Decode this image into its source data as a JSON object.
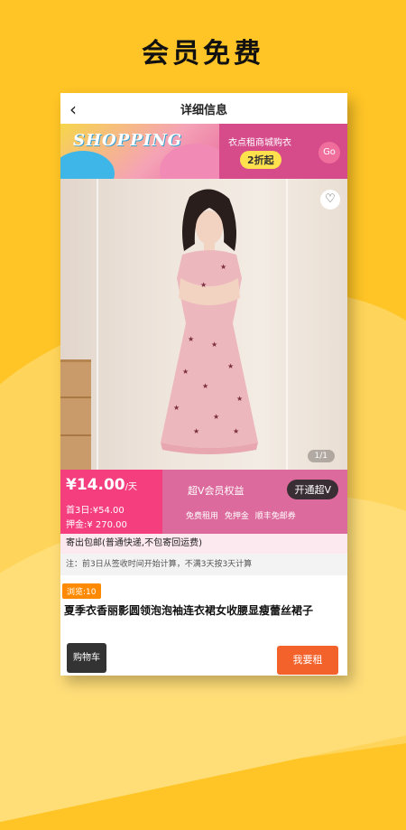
{
  "promo": {
    "title": "会员免费"
  },
  "navbar": {
    "back_icon": "‹",
    "title": "详细信息"
  },
  "banner": {
    "shop_text": "SHOPPING",
    "text": "衣点租商城购衣",
    "discount": "2折起",
    "go_label": "Go"
  },
  "gallery": {
    "heart_icon": "♡",
    "page_indicator": "1/1"
  },
  "price": {
    "daily": "¥14.00",
    "daily_unit": "/天",
    "first_days": "首3日:¥54.00",
    "deposit": "押金:¥ 270.00"
  },
  "vip": {
    "title": "超V会员权益",
    "button": "开通超V",
    "perks": "免费租用 免押金 顺丰免邮券"
  },
  "shipping": {
    "text": "寄出包邮(普通快递,不包寄回运费)"
  },
  "note": {
    "text": "注：前3日从签收时间开始计算，不满3天按3天计算"
  },
  "product": {
    "views": "浏览:10",
    "title": "夏季衣香丽影圆领泡泡袖连衣裙女收腰显瘦蕾丝裙子"
  },
  "actions": {
    "cart": "购物车",
    "rent": "我要租"
  },
  "colors": {
    "background": "#FFC526",
    "price_pink": "#F53E7D",
    "vip_pink": "#DC6A9C",
    "rent_orange": "#F4622B",
    "views_orange": "#FF8A00"
  }
}
